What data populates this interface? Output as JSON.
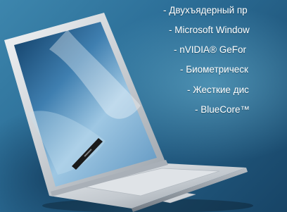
{
  "features": [
    "- Двухъядерный  пр",
    "- Microsoft Window",
    "- nVIDIA® GeFor",
    "- Биометрическ",
    "- Жесткие дис",
    "- BlueCore™"
  ]
}
